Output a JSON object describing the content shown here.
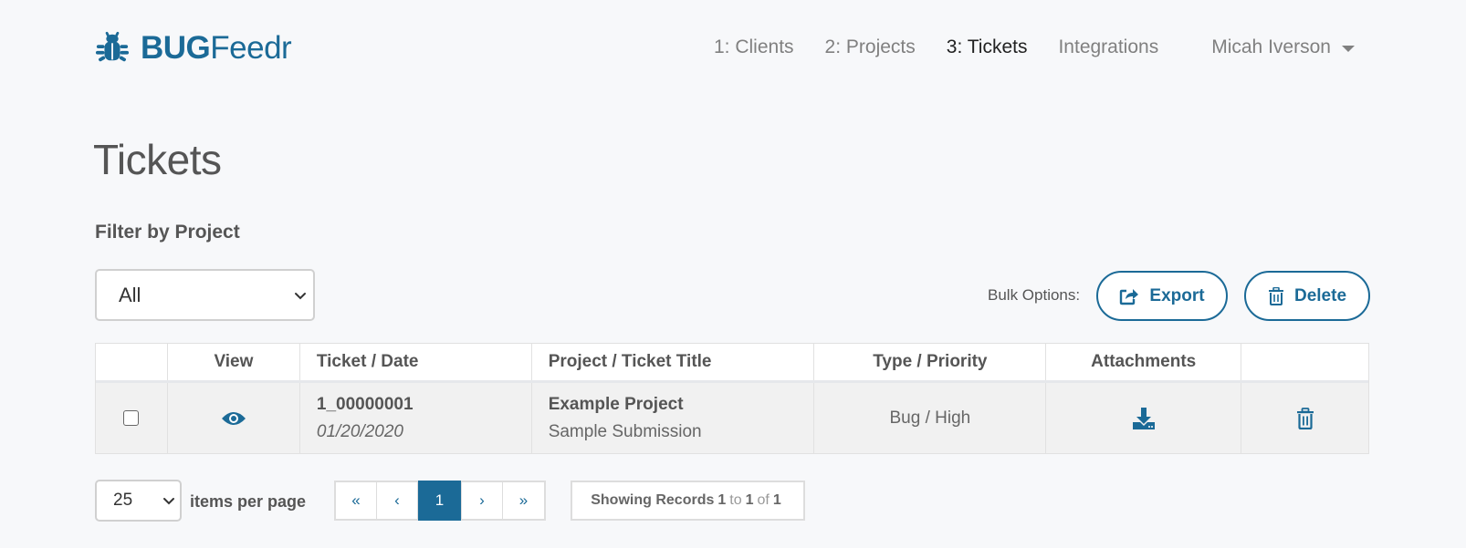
{
  "brand": {
    "bold": "BUG",
    "thin": "Feedr"
  },
  "nav": {
    "items": [
      {
        "label": "1: Clients"
      },
      {
        "label": "2: Projects"
      },
      {
        "label": "3: Tickets",
        "active": true
      },
      {
        "label": "Integrations"
      }
    ],
    "user": "Micah Iverson"
  },
  "page": {
    "title": "Tickets"
  },
  "filter": {
    "label": "Filter by Project",
    "selected": "All"
  },
  "bulk": {
    "label": "Bulk Options:",
    "export": "Export",
    "delete": "Delete"
  },
  "table": {
    "headers": [
      "",
      "View",
      "Ticket / Date",
      "Project / Ticket Title",
      "Type / Priority",
      "Attachments",
      ""
    ],
    "rows": [
      {
        "ticket_id": "1_00000001",
        "date": "01/20/2020",
        "project": "Example Project",
        "title": "Sample Submission",
        "type_priority": "Bug / High"
      }
    ]
  },
  "pagination": {
    "per_page": "25",
    "per_page_label": "items per page",
    "first": "«",
    "prev": "‹",
    "current": "1",
    "next": "›",
    "last": "»",
    "records": {
      "prefix": "Showing Records",
      "from": "1",
      "to_word": "to",
      "to": "1",
      "of_word": "of",
      "total": "1"
    }
  },
  "colors": {
    "accent": "#1b6a97",
    "background": "#f7f8fa",
    "row_bg": "#f1f1f1"
  },
  "icons": [
    "bug-logo-icon",
    "eye-icon",
    "download-icon",
    "trash-icon",
    "share-icon",
    "chevron-down-icon"
  ]
}
